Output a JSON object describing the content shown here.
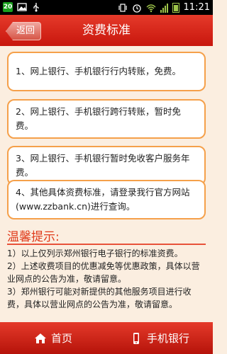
{
  "statusbar": {
    "time": "11:21",
    "notification_badge": "20"
  },
  "header": {
    "back_label": "返回",
    "title": "资费标准"
  },
  "cards": [
    "1、网上银行、手机银行行内转账，免费。",
    "2、网上银行、手机银行跨行转账，暂时免费。",
    "3、网上银行、手机银行暂时免收客户服务年费。",
    "4、其他具体资费标准，请登录我行官方网站(www.zzbank.cn)进行查询。"
  ],
  "tips": {
    "title": "温馨提示:",
    "items": [
      "1）以上仅列示郑州银行电子银行的标准资费。",
      "2）上述收费项目的优惠减免等优惠政策，具体以营业网点的公告为准，敬请留意。",
      "3）郑州银行可能对新提供的其他服务项目进行收费，具体以营业网点的公告为准，敬请留意。"
    ]
  },
  "bottom_nav": {
    "home_label": "首页",
    "mobile_bank_label": "手机银行"
  },
  "colors": {
    "header_red": "#d9271a",
    "card_border": "#f5a04a",
    "tips_title": "#e03a1a",
    "page_bg": "#fbeee0"
  }
}
